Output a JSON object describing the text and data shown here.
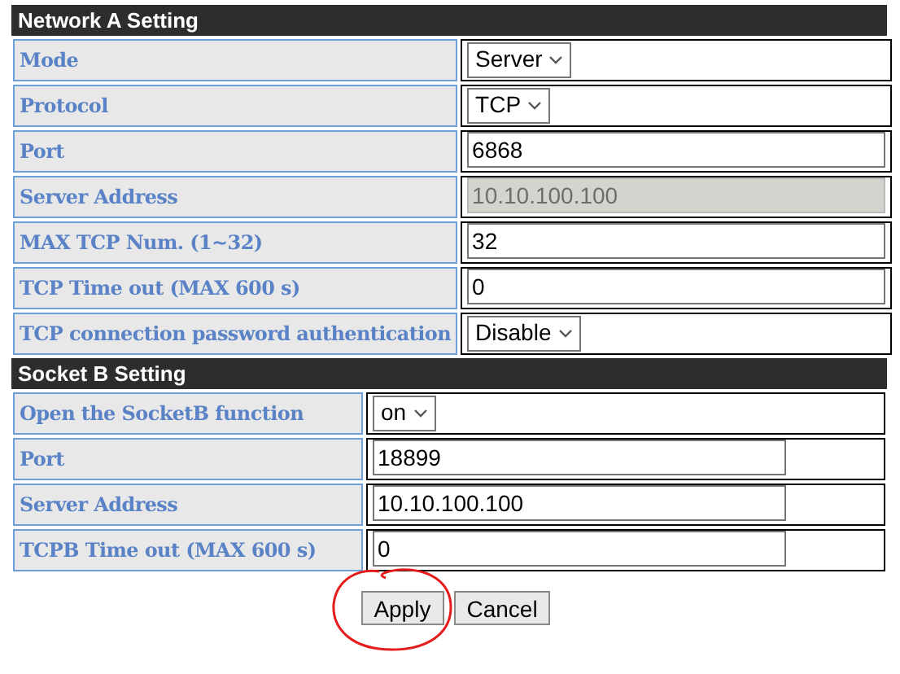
{
  "sections": [
    {
      "title": "Network A Setting",
      "rows": [
        {
          "label": "Mode",
          "kind": "select",
          "value": "Server",
          "disabled": false
        },
        {
          "label": "Protocol",
          "kind": "select",
          "value": "TCP",
          "disabled": false
        },
        {
          "label": "Port",
          "kind": "input",
          "value": "6868",
          "disabled": false
        },
        {
          "label": "Server Address",
          "kind": "input",
          "value": "10.10.100.100",
          "disabled": true
        },
        {
          "label": "MAX TCP Num. (1~32)",
          "kind": "input",
          "value": "32",
          "disabled": false
        },
        {
          "label": "TCP Time out (MAX 600 s)",
          "kind": "input",
          "value": "0",
          "disabled": false
        },
        {
          "label": "TCP connection password authentication",
          "kind": "select",
          "value": "Disable",
          "disabled": false
        }
      ]
    },
    {
      "title": "Socket B Setting",
      "rows": [
        {
          "label": "Open the SocketB function",
          "kind": "select",
          "value": "on",
          "disabled": false
        },
        {
          "label": "Port",
          "kind": "input",
          "value": "18899",
          "disabled": false
        },
        {
          "label": "Server Address",
          "kind": "input",
          "value": "10.10.100.100",
          "disabled": false
        },
        {
          "label": "TCPB Time out (MAX 600 s)",
          "kind": "input",
          "value": "0",
          "disabled": false
        }
      ]
    }
  ],
  "buttons": [
    "Apply",
    "Cancel"
  ]
}
